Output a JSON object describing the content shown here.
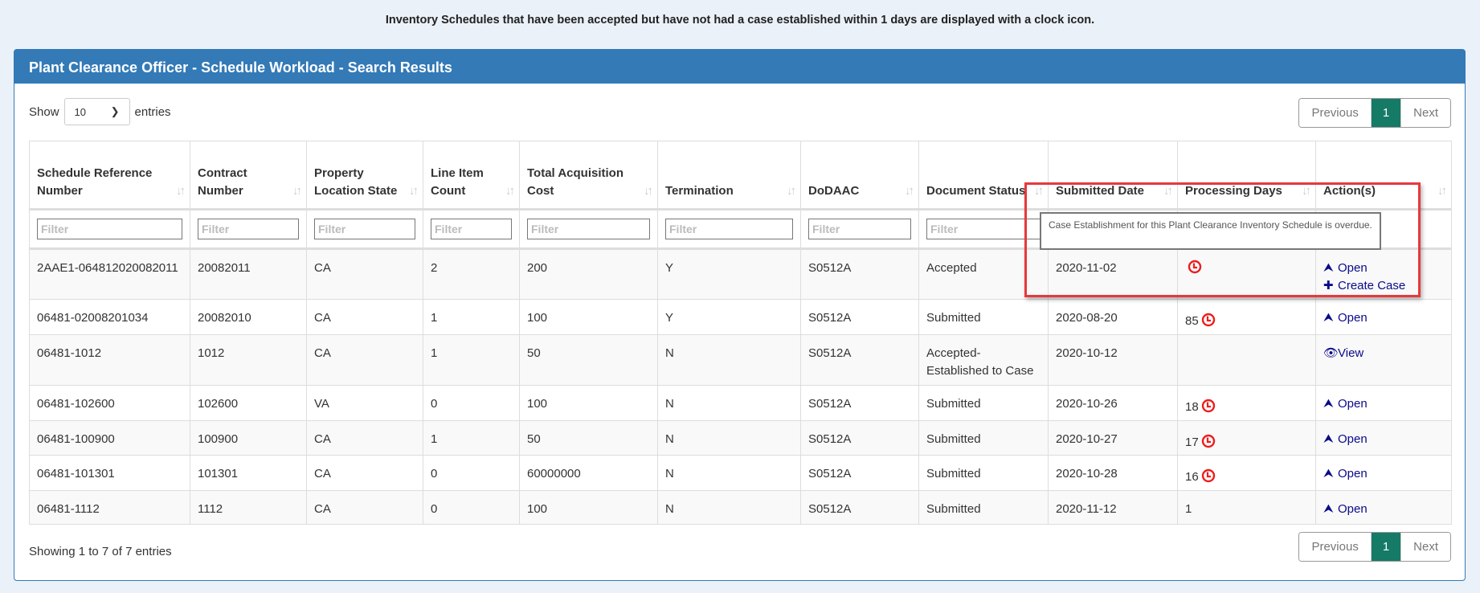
{
  "banner": "Inventory Schedules that have been accepted but have not had a case established within 1 days are displayed with a clock icon.",
  "panel_title": "Plant Clearance Officer - Schedule Workload - Search Results",
  "length": {
    "show": "Show",
    "value": "10",
    "entries": "entries"
  },
  "pager": {
    "previous": "Previous",
    "page": "1",
    "next": "Next"
  },
  "filter_placeholder": "Filter",
  "columns": [
    "Schedule Reference Number",
    "Contract Number",
    "Property Location State",
    "Line Item Count",
    "Total Acquisition Cost",
    "Termination",
    "DoDAAC",
    "Document Status",
    "Submitted Date",
    "Processing Days",
    "Action(s)"
  ],
  "rows": [
    {
      "ref": "2AAE1-064812020082011",
      "contract": "20082011",
      "state": "CA",
      "count": "2",
      "cost": "200",
      "term": "Y",
      "dodaac": "S0512A",
      "status": "Accepted",
      "date": "2020-11-02",
      "days": "",
      "clock": true,
      "actions": [
        {
          "icon": "upload-icon",
          "label": "Open"
        },
        {
          "icon": "plus-icon",
          "label": "Create Case"
        }
      ]
    },
    {
      "ref": "06481-02008201034",
      "contract": "20082010",
      "state": "CA",
      "count": "1",
      "cost": "100",
      "term": "Y",
      "dodaac": "S0512A",
      "status": "Submitted",
      "date": "2020-08-20",
      "days": "85",
      "clock": true,
      "actions": [
        {
          "icon": "upload-icon",
          "label": "Open"
        }
      ]
    },
    {
      "ref": "06481-1012",
      "contract": "1012",
      "state": "CA",
      "count": "1",
      "cost": "50",
      "term": "N",
      "dodaac": "S0512A",
      "status": "Accepted-Established to Case",
      "date": "2020-10-12",
      "days": "",
      "clock": false,
      "actions": [
        {
          "icon": "eye-icon",
          "label": "View"
        }
      ]
    },
    {
      "ref": "06481-102600",
      "contract": "102600",
      "state": "VA",
      "count": "0",
      "cost": "100",
      "term": "N",
      "dodaac": "S0512A",
      "status": "Submitted",
      "date": "2020-10-26",
      "days": "18",
      "clock": true,
      "actions": [
        {
          "icon": "upload-icon",
          "label": "Open"
        }
      ]
    },
    {
      "ref": "06481-100900",
      "contract": "100900",
      "state": "CA",
      "count": "1",
      "cost": "50",
      "term": "N",
      "dodaac": "S0512A",
      "status": "Submitted",
      "date": "2020-10-27",
      "days": "17",
      "clock": true,
      "actions": [
        {
          "icon": "upload-icon",
          "label": "Open"
        }
      ]
    },
    {
      "ref": "06481-101301",
      "contract": "101301",
      "state": "CA",
      "count": "0",
      "cost": "60000000",
      "term": "N",
      "dodaac": "S0512A",
      "status": "Submitted",
      "date": "2020-10-28",
      "days": "16",
      "clock": true,
      "actions": [
        {
          "icon": "upload-icon",
          "label": "Open"
        }
      ]
    },
    {
      "ref": "06481-1112",
      "contract": "1112",
      "state": "CA",
      "count": "0",
      "cost": "100",
      "term": "N",
      "dodaac": "S0512A",
      "status": "Submitted",
      "date": "2020-11-12",
      "days": "1",
      "clock": false,
      "actions": [
        {
          "icon": "upload-icon",
          "label": "Open"
        }
      ]
    }
  ],
  "info": "Showing 1 to 7 of 7 entries",
  "tooltip": "Case Establishment for this Plant Clearance Inventory Schedule is overdue.",
  "colors": {
    "header": "#337ab7",
    "active_page": "#157a66",
    "clock": "#ee1c1c",
    "link": "#0a0a8a"
  }
}
